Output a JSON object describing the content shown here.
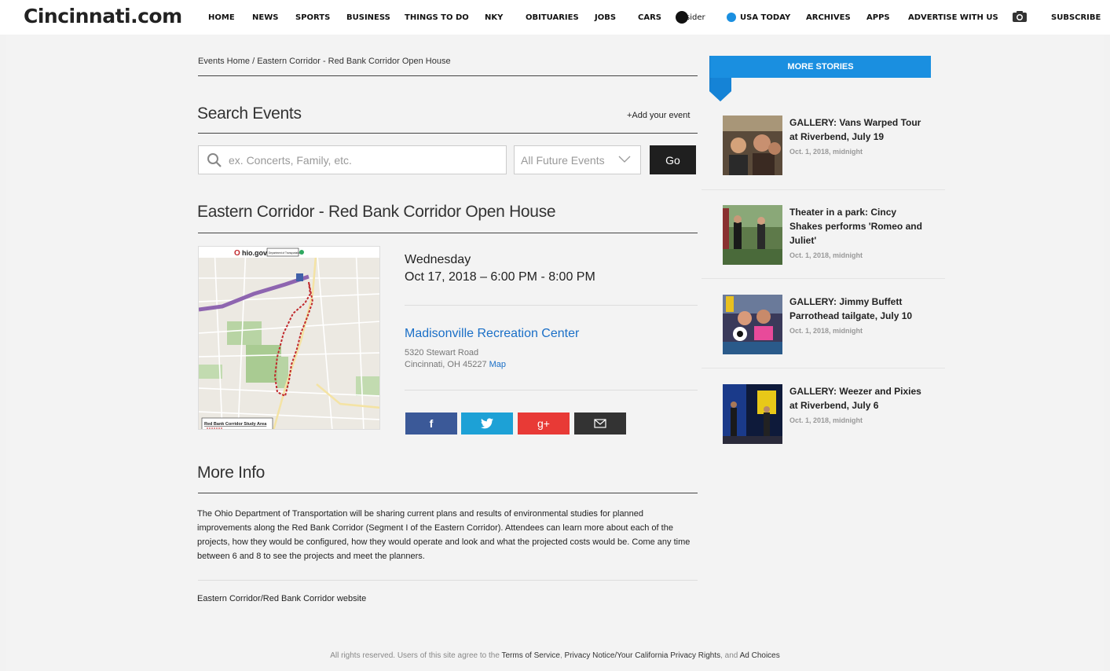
{
  "header": {
    "logo": "Cincinnati.com",
    "nav": [
      "HOME",
      "NEWS",
      "SPORTS",
      "BUSINESS",
      "THINGS TO DO",
      "NKY",
      "OBITUARIES",
      "JOBS",
      "CARS",
      "sider",
      "USA TODAY",
      "ARCHIVES",
      "APPS",
      "ADVERTISE WITH US",
      "SUBSCRIBE"
    ]
  },
  "breadcrumb": "Events Home / Eastern Corridor - Red Bank Corridor Open House",
  "search": {
    "heading": "Search Events",
    "add_event": "+Add your event",
    "placeholder": "ex. Concerts, Family, etc.",
    "filter_value": "All Future Events",
    "go_label": "Go"
  },
  "event": {
    "title": "Eastern Corridor - Red Bank Corridor Open House",
    "day": "Wednesday",
    "datetime": "Oct 17, 2018 – 6:00 PM - 8:00 PM",
    "venue": "Madisonville Recreation Center",
    "address_line1": "5320 Stewart Road",
    "address_line2": "Cincinnati, OH 45227",
    "map_link": "Map",
    "map_image": {
      "brand": "hio.gov",
      "dept": "Department of Transportation",
      "legend": "Red Bank Corridor Study Area"
    }
  },
  "share": {
    "facebook": "f",
    "googleplus": "g+"
  },
  "more_info": {
    "heading": "More Info",
    "text": "The Ohio Department of Transportation will be sharing current plans and results of environmental studies for planned improvements along the Red Bank Corridor (Segment I of the Eastern Corridor). Attendees can learn more about each of the projects, how they would be configured, how they would operate and look and what the projected costs would be. Come any time between 6 and 8 to see the projects and meet the planners.",
    "website": "Eastern Corridor/Red Bank Corridor website"
  },
  "sidebar": {
    "banner": "MORE STORIES",
    "stories": [
      {
        "title": "GALLERY: Vans Warped Tour at Riverbend, July 19",
        "date": "Oct. 1, 2018, midnight"
      },
      {
        "title": "Theater in a park: Cincy Shakes performs 'Romeo and Juliet'",
        "date": "Oct. 1, 2018, midnight"
      },
      {
        "title": "GALLERY: Jimmy Buffett Parrothead tailgate, July 10",
        "date": "Oct. 1, 2018, midnight"
      },
      {
        "title": "GALLERY: Weezer and Pixies at Riverbend, July 6",
        "date": "Oct. 1, 2018, midnight"
      }
    ]
  },
  "footer": {
    "prefix": "All rights reserved. Users of this site agree to the",
    "tos": "Terms of Service",
    "privacy": "Privacy Notice/Your California Privacy Rights",
    "and": ", and",
    "ad_choices": "Ad Choices"
  },
  "colors": {
    "accent": "#1a8fe0",
    "link": "#1a6fc7",
    "facebook": "#3b5998",
    "twitter": "#1da1d6",
    "googleplus": "#e83a36"
  }
}
